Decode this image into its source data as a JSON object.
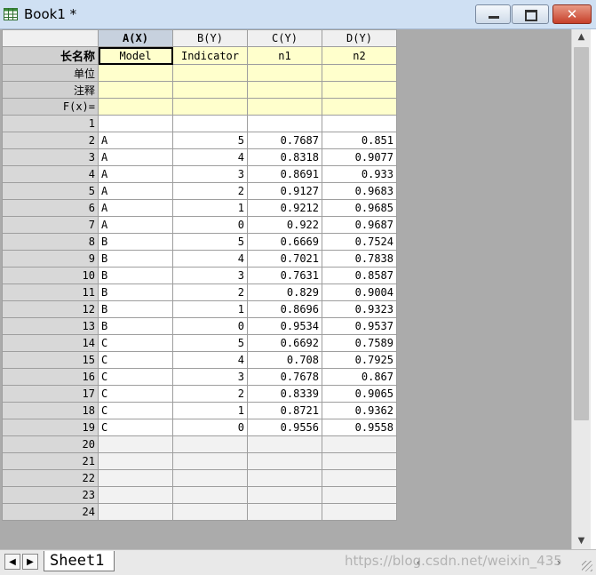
{
  "window": {
    "title": "Book1 *",
    "close_glyph": "✕"
  },
  "columns": [
    {
      "header": "A(X)",
      "long_name": "Model"
    },
    {
      "header": "B(Y)",
      "long_name": "Indicator"
    },
    {
      "header": "C(Y)",
      "long_name": "n1"
    },
    {
      "header": "D(Y)",
      "long_name": "n2"
    }
  ],
  "meta_labels": {
    "long_name": "长名称",
    "units": "单位",
    "comments": "注释",
    "fx": "F(x)="
  },
  "rows": [
    {
      "n": "1",
      "cells": [
        "",
        "",
        "",
        ""
      ]
    },
    {
      "n": "2",
      "cells": [
        "A",
        "5",
        "0.7687",
        "0.851"
      ]
    },
    {
      "n": "3",
      "cells": [
        "A",
        "4",
        "0.8318",
        "0.9077"
      ]
    },
    {
      "n": "4",
      "cells": [
        "A",
        "3",
        "0.8691",
        "0.933"
      ]
    },
    {
      "n": "5",
      "cells": [
        "A",
        "2",
        "0.9127",
        "0.9683"
      ]
    },
    {
      "n": "6",
      "cells": [
        "A",
        "1",
        "0.9212",
        "0.9685"
      ]
    },
    {
      "n": "7",
      "cells": [
        "A",
        "0",
        "0.922",
        "0.9687"
      ]
    },
    {
      "n": "8",
      "cells": [
        "B",
        "5",
        "0.6669",
        "0.7524"
      ]
    },
    {
      "n": "9",
      "cells": [
        "B",
        "4",
        "0.7021",
        "0.7838"
      ]
    },
    {
      "n": "10",
      "cells": [
        "B",
        "3",
        "0.7631",
        "0.8587"
      ]
    },
    {
      "n": "11",
      "cells": [
        "B",
        "2",
        "0.829",
        "0.9004"
      ]
    },
    {
      "n": "12",
      "cells": [
        "B",
        "1",
        "0.8696",
        "0.9323"
      ]
    },
    {
      "n": "13",
      "cells": [
        "B",
        "0",
        "0.9534",
        "0.9537"
      ]
    },
    {
      "n": "14",
      "cells": [
        "C",
        "5",
        "0.6692",
        "0.7589"
      ]
    },
    {
      "n": "15",
      "cells": [
        "C",
        "4",
        "0.708",
        "0.7925"
      ]
    },
    {
      "n": "16",
      "cells": [
        "C",
        "3",
        "0.7678",
        "0.867"
      ]
    },
    {
      "n": "17",
      "cells": [
        "C",
        "2",
        "0.8339",
        "0.9065"
      ]
    },
    {
      "n": "18",
      "cells": [
        "C",
        "1",
        "0.8721",
        "0.9362"
      ]
    },
    {
      "n": "19",
      "cells": [
        "C",
        "0",
        "0.9556",
        "0.9558"
      ]
    },
    {
      "n": "20",
      "cells": null
    },
    {
      "n": "21",
      "cells": null
    },
    {
      "n": "22",
      "cells": null
    },
    {
      "n": "23",
      "cells": null
    },
    {
      "n": "24",
      "cells": null
    }
  ],
  "sheet_tab": "Sheet1",
  "watermark": "https://blog.csdn.net/weixin_435",
  "icons": {
    "app": "worksheet-icon",
    "minimize": "minimize-icon",
    "maximize": "maximize-icon",
    "close": "close-icon",
    "nav_left": "tab-left-arrow-icon",
    "nav_right": "tab-right-arrow-icon",
    "scroll_up": "scroll-up-arrow-icon",
    "scroll_down": "scroll-down-arrow-icon"
  },
  "colors": {
    "titlebar": "#cfe0f3",
    "meta_row": "#ffffcc",
    "selected_header": "#c7d1de",
    "close_button": "#c7402a"
  }
}
